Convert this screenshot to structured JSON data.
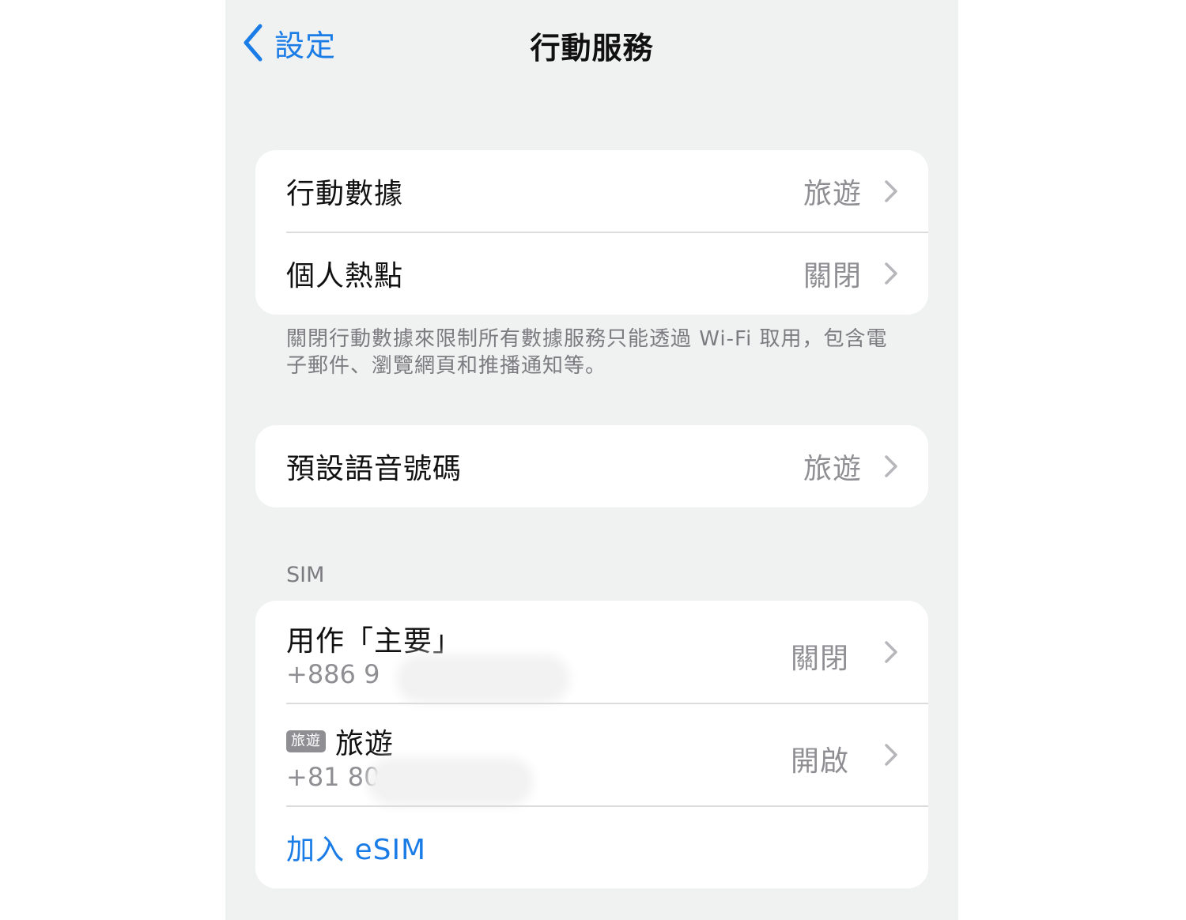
{
  "nav": {
    "back_label": "設定",
    "title": "行動服務"
  },
  "group1": {
    "rows": [
      {
        "label": "行動數據",
        "value": "旅遊"
      },
      {
        "label": "個人熱點",
        "value": "關閉"
      }
    ],
    "footer": "關閉行動數據來限制所有數據服務只能透過 Wi-Fi 取用，包含電子郵件、瀏覽網頁和推播通知等。"
  },
  "group2": {
    "rows": [
      {
        "label": "預設語音號碼",
        "value": "旅遊"
      }
    ]
  },
  "sim": {
    "header": "SIM",
    "lines": [
      {
        "title": "用作「主要」",
        "number": "+886 9",
        "value": "關閉"
      },
      {
        "badge": "旅遊",
        "title": "旅遊",
        "number": "+81 80",
        "value": "開啟"
      }
    ],
    "add_esim": "加入 eSIM"
  },
  "colors": {
    "accent": "#1a7ce6",
    "background": "#f0f1f1",
    "secondary_text": "#8e8e93"
  }
}
